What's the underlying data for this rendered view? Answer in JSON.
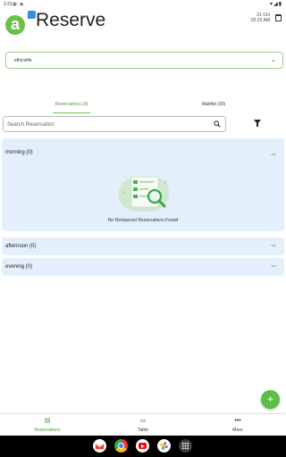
{
  "status_bar": {
    "time": "2:22",
    "icons_left": [
      "gmail-icon",
      "android-icon"
    ],
    "icons_right": [
      "wifi-icon",
      "signal-icon",
      "battery-icon"
    ]
  },
  "header": {
    "logo_letter": "a",
    "app_title": "Reserve",
    "date": "21 Oct",
    "time": "02:22 AM",
    "brand_green": "#6cc04a",
    "brand_blue": "#3a8dde"
  },
  "restaurant_select": {
    "value": "ethicsfife"
  },
  "tabs": [
    {
      "label": "Reservations (0)",
      "active": true
    },
    {
      "label": "Waitlist (30)",
      "active": false
    }
  ],
  "search": {
    "placeholder": "Search Reservation"
  },
  "sections": [
    {
      "title": "morning (0)",
      "expanded": true,
      "empty_message": "No Restaurant Reservations Found"
    },
    {
      "title": "afternoon (0)",
      "expanded": false
    },
    {
      "title": "evening (0)",
      "expanded": false
    }
  ],
  "fab": {
    "label": "+"
  },
  "bottom_nav": [
    {
      "label": "Reservations",
      "icon": "reservations-icon",
      "active": true
    },
    {
      "label": "Table",
      "icon": "table-icon",
      "active": false
    },
    {
      "label": "More",
      "icon": "more-icon",
      "active": false
    }
  ],
  "taskbar_apps": [
    "gmail-app",
    "chrome-app",
    "youtube-app",
    "photos-app",
    "app-drawer"
  ]
}
